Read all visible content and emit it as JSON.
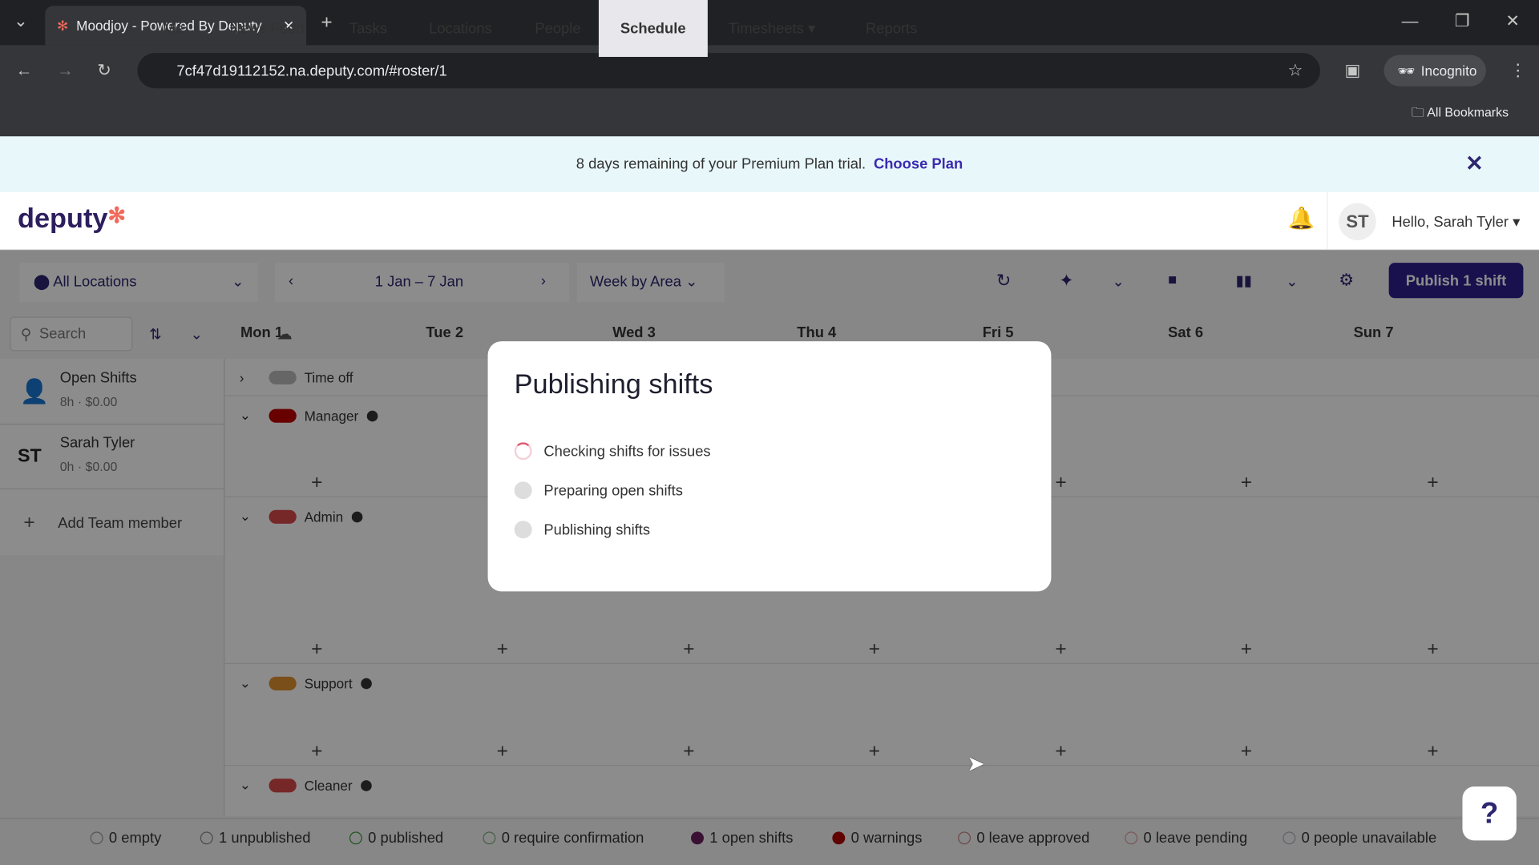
{
  "browser": {
    "tab_title": "Moodjoy - Powered By Deputy",
    "url": "7cf47d19112152.na.deputy.com/#roster/1",
    "incognito": "Incognito",
    "bookmarks": "All Bookmarks"
  },
  "banner": {
    "text": "8 days remaining of your Premium Plan trial.",
    "link": "Choose Plan"
  },
  "nav": {
    "logo": "deputy",
    "items": [
      "Me",
      "News Feed",
      "Tasks",
      "Locations",
      "People",
      "Schedule",
      "Timesheets",
      "Reports"
    ],
    "active": "Schedule",
    "avatar": "ST",
    "greeting": "Hello, Sarah Tyler"
  },
  "toolbar": {
    "location": "All Locations",
    "date_range": "1 Jan – 7 Jan",
    "view": "Week by Area",
    "publish": "Publish 1 shift",
    "search_placeholder": "Search"
  },
  "days": [
    "Mon 1",
    "Tue 2",
    "Wed 3",
    "Thu 4",
    "Fri 5",
    "Sat 6",
    "Sun 7"
  ],
  "team": [
    {
      "name": "Open Shifts",
      "meta": "8h · $0.00"
    },
    {
      "avatar": "ST",
      "name": "Sarah Tyler",
      "meta": "0h · $0.00"
    }
  ],
  "add_member": "Add Team member",
  "areas": [
    {
      "name": "Time off",
      "color": "#bbbbbb"
    },
    {
      "name": "Manager",
      "color": "#c00000"
    },
    {
      "name": "Admin",
      "color": "#d84848"
    },
    {
      "name": "Support",
      "color": "#e09030"
    },
    {
      "name": "Cleaner",
      "color": "#d84848"
    }
  ],
  "modal": {
    "title": "Publishing shifts",
    "steps": [
      {
        "label": "Checking shifts for issues",
        "state": "in-progress"
      },
      {
        "label": "Preparing open shifts",
        "state": "pending"
      },
      {
        "label": "Publishing shifts",
        "state": "pending"
      }
    ]
  },
  "legend": [
    {
      "label": "0 empty",
      "color": "#999999"
    },
    {
      "label": "1 unpublished",
      "color": "#888888"
    },
    {
      "label": "0 published",
      "color": "#3a9a3a"
    },
    {
      "label": "0 require confirmation",
      "color": "#7ab07a"
    },
    {
      "label": "1 open shifts",
      "color": "#6b1f5e"
    },
    {
      "label": "0 warnings",
      "color": "#b00000"
    },
    {
      "label": "0 leave approved",
      "color": "#d08080"
    },
    {
      "label": "0 leave pending",
      "color": "#e0a0a0"
    },
    {
      "label": "0 people unavailable",
      "color": "#b0b0c0"
    }
  ],
  "help": "?",
  "colors": {
    "brand": "#2d1f8f",
    "accent": "#e0566f"
  }
}
